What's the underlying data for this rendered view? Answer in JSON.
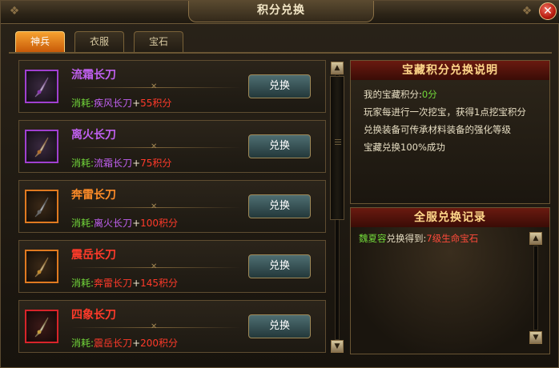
{
  "window": {
    "title": "积分兑换",
    "close_label": "✕"
  },
  "tabs": [
    {
      "label": "神兵",
      "active": true
    },
    {
      "label": "衣服",
      "active": false
    },
    {
      "label": "宝石",
      "active": false
    }
  ],
  "items": [
    {
      "name": "流霜长刀",
      "rarity": "purple",
      "cost_label": "消耗:",
      "req_item": "疾风长刀",
      "plus": "+",
      "points": "55积分",
      "button": "兑换",
      "icon": "purple-blade-icon"
    },
    {
      "name": "离火长刀",
      "rarity": "purple",
      "cost_label": "消耗:",
      "req_item": "流霜长刀",
      "plus": "+",
      "points": "75积分",
      "button": "兑换",
      "icon": "purple-blade-icon"
    },
    {
      "name": "奔雷长刀",
      "rarity": "orange",
      "cost_label": "消耗:",
      "req_item": "离火长刀",
      "plus": "+",
      "points": "100积分",
      "button": "兑换",
      "icon": "orange-blade-icon"
    },
    {
      "name": "震岳长刀",
      "rarity": "orange",
      "cost_label": "消耗:",
      "req_item": "奔雷长刀",
      "plus": "+",
      "points": "145积分",
      "button": "兑换",
      "icon": "orange-blade-icon"
    },
    {
      "name": "四象长刀",
      "rarity": "red",
      "cost_label": "消耗:",
      "req_item": "震岳长刀",
      "plus": "+",
      "points": "200积分",
      "button": "兑换",
      "icon": "red-blade-icon"
    }
  ],
  "info_panel": {
    "title": "宝藏积分兑换说明",
    "points_label": "我的宝藏积分:",
    "points_value": "0分",
    "lines": [
      "玩家每进行一次挖宝，获得1点挖宝积分",
      "兑换装备可传承材料装备的强化等级",
      "宝藏兑换100%成功"
    ]
  },
  "record_panel": {
    "title": "全服兑换记录",
    "records": [
      {
        "player": "魏夏容",
        "action": "兑换得到:",
        "item": "7级生命宝石"
      }
    ]
  },
  "scroll": {
    "up": "▲",
    "down": "▼"
  },
  "colors": {
    "purple": "#c060f0",
    "orange": "#ff8c28",
    "red": "#ff3a2a",
    "green": "#72d83a",
    "active_tab": "#e07818"
  }
}
